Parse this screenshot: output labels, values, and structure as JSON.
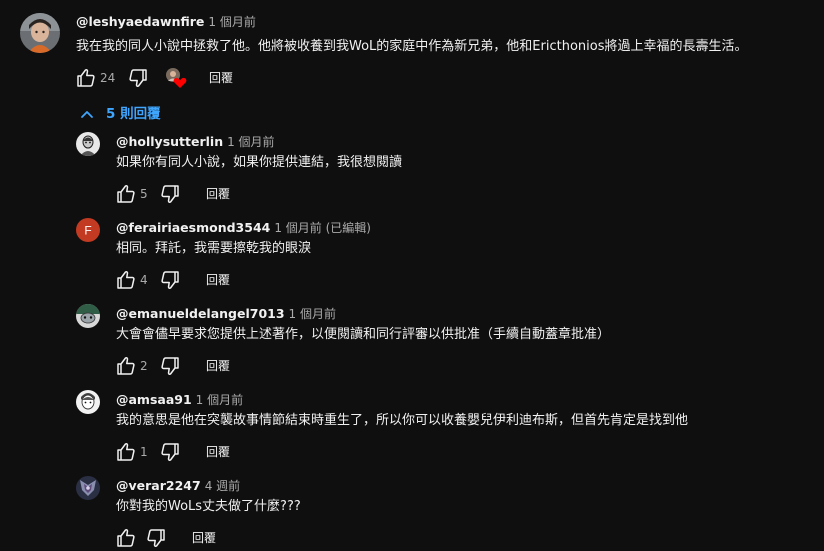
{
  "top_comment": {
    "author": "@leshyaedawnfire",
    "time": "1 個月前",
    "text": "我在我的同人小說中拯救了他。他將被收養到我WoL的家庭中作為新兄弟，他和Ericthonios將過上幸福的長壽生活。",
    "likes": "24",
    "reply_label": "回覆",
    "avatar_icon": "user-avatar-photo",
    "heart_icon": "creator-heart-icon"
  },
  "replies_toggle": {
    "label": "5 則回覆",
    "icon": "chevron-up-icon",
    "color": "#3ea6ff"
  },
  "replies": [
    {
      "author": "@hollysutterlin",
      "time": "1 個月前",
      "text": "如果你有同人小說，如果你提供連結，我很想閱讀",
      "likes": "5",
      "reply_label": "回覆"
    },
    {
      "author": "@ferairiaesmond3544",
      "time": "1 個月前 (已編輯)",
      "text": "相同。拜託，我需要擦乾我的眼淚",
      "likes": "4",
      "reply_label": "回覆",
      "avatar_letter": "F",
      "avatar_color": "#c23a22"
    },
    {
      "author": "@emanueldelangel7013",
      "time": "1 個月前",
      "text": "大會會儘早要求您提供上述著作，以便閱讀和同行評審以供批准（手續自動蓋章批准）",
      "likes": "2",
      "reply_label": "回覆"
    },
    {
      "author": "@amsaa91",
      "time": "1 個月前",
      "text": "我的意思是他在突襲故事情節結束時重生了，所以你可以收養嬰兒伊利迪布斯，但首先肯定是找到他",
      "likes": "1",
      "reply_label": "回覆"
    },
    {
      "author": "@verar2247",
      "time": "4 週前",
      "text": "你對我的WoLs丈夫做了什麼???",
      "likes": "",
      "reply_label": "回覆"
    }
  ]
}
